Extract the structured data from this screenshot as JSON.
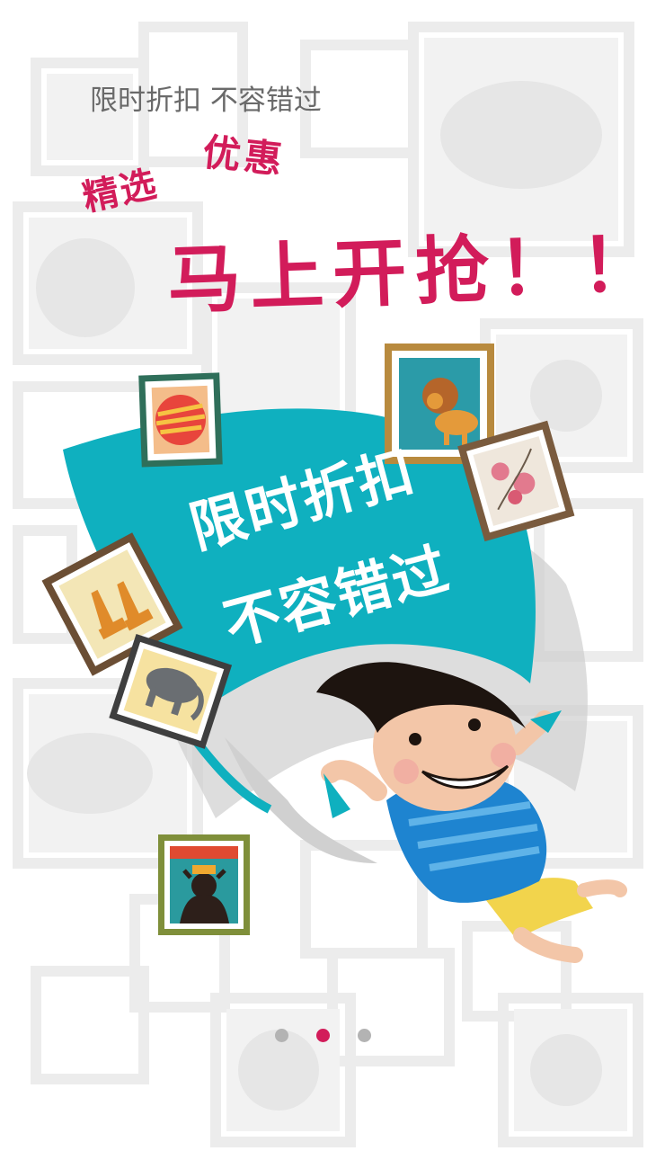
{
  "splash": {
    "subtitle": "限时折扣 不容错过",
    "headline_small_left": "精选",
    "headline_small_right": "优惠",
    "headline_main": "马上开抢！！",
    "flag_line_1": "限时折扣",
    "flag_line_2": "不容错过"
  },
  "pager": {
    "active_index": 1,
    "dots": [
      "page-1",
      "page-2",
      "page-3"
    ]
  },
  "colors": {
    "accent": "#d21c5a",
    "flag": "#0fb0bf",
    "dot_inactive": "#b3b3b3"
  }
}
